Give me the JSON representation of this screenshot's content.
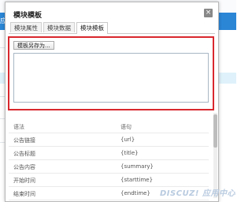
{
  "background": {
    "strip_text": "应用中心"
  },
  "dialog": {
    "title": "模块模板",
    "close_symbol": "×",
    "tabs": [
      {
        "label": "模块属性",
        "active": false
      },
      {
        "label": "模块数据",
        "active": false
      },
      {
        "label": "模块模板",
        "active": true
      }
    ],
    "save_as_button": "模板另存为...",
    "editor_value": ""
  },
  "table": {
    "headers": [
      "语法",
      "语句"
    ],
    "rows": [
      [
        "公告链接",
        "{url}"
      ],
      [
        "公告标题",
        "{title}"
      ],
      [
        "公告内容",
        "{summary}"
      ],
      [
        "开始时间",
        "{starttime}"
      ],
      [
        "结束时间",
        "{endtime}"
      ]
    ]
  },
  "watermark": "DISCUZ! 应用中心",
  "colors": {
    "highlight_border": "#d9282e",
    "background_blue": "#2b86d6",
    "band_light_blue": "#dff2fb"
  }
}
